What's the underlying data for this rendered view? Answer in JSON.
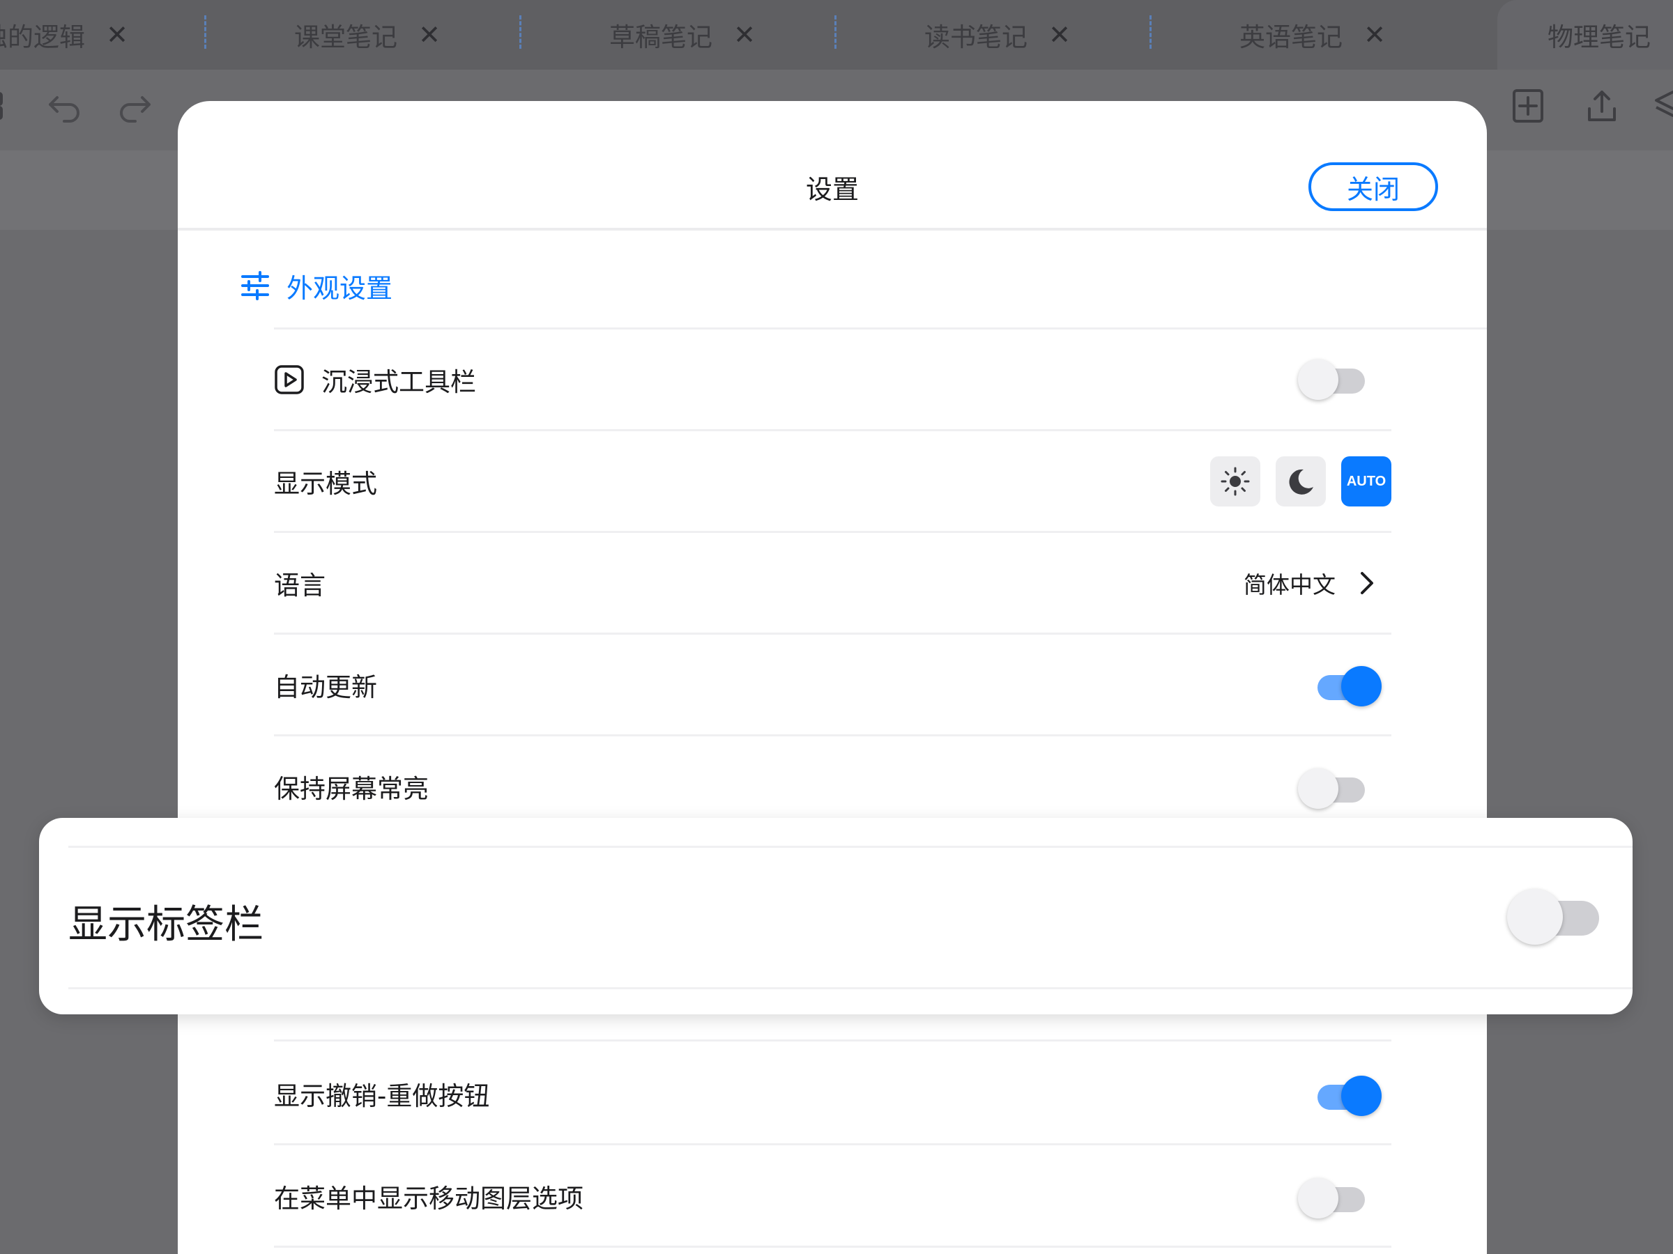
{
  "tabs": [
    {
      "title": "蚀的逻辑",
      "close": "✕"
    },
    {
      "title": "课堂笔记",
      "close": "✕"
    },
    {
      "title": "草稿笔记",
      "close": "✕"
    },
    {
      "title": "读书笔记",
      "close": "✕"
    },
    {
      "title": "英语笔记",
      "close": "✕"
    },
    {
      "title": "物理笔记"
    }
  ],
  "modal": {
    "title": "设置",
    "close_label": "关闭",
    "section_title": "外观设置"
  },
  "settings": {
    "immersive_toolbar": {
      "label": "沉浸式工具栏",
      "enabled": false
    },
    "display_mode": {
      "label": "显示模式",
      "auto_label": "AUTO",
      "selected": "AUTO"
    },
    "language": {
      "label": "语言",
      "value": "简体中文"
    },
    "auto_update": {
      "label": "自动更新",
      "enabled": true
    },
    "keep_screen_on": {
      "label": "保持屏幕常亮",
      "enabled": false
    },
    "show_tab_bar": {
      "label": "显示标签栏",
      "enabled": false
    },
    "show_undo_redo": {
      "label": "显示撤销-重做按钮",
      "enabled": true
    },
    "show_move_layer": {
      "label": "在菜单中显示移动图层选项",
      "enabled": false
    }
  },
  "colors": {
    "accent": "#0a7aff",
    "toggle_on_track": "#65a8ff",
    "toggle_off_track": "#cfcfd3"
  }
}
